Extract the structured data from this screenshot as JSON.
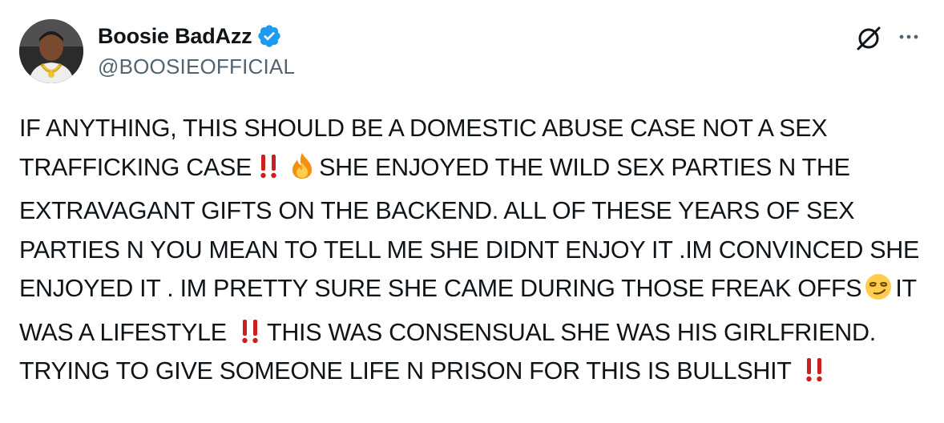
{
  "author": {
    "display_name": "Boosie BadAzz",
    "handle": "@BOOSIEOFFICIAL",
    "verified": true,
    "avatar_icon": "profile-photo"
  },
  "actions": {
    "grok_icon": "grok-icon",
    "more_icon": "more-options-icon"
  },
  "colors": {
    "verified_badge": "#1d9bf0",
    "handle": "#536471",
    "text": "#0f1419",
    "bang_emoji": "#cc1f1f"
  },
  "tweet": {
    "seg1": "IF ANYTHING, THIS SHOULD BE A DOMESTIC ABUSE CASE NOT A SEX TRAFFICKING CASE",
    "seg2": "SHE ENJOYED THE WILD SEX PARTIES N THE EXTRAVAGANT GIFTS ON THE BACKEND. ALL OF THESE YEARS OF SEX PARTIES N YOU MEAN TO TELL ME SHE DIDNT ENJOY IT .IM CONVINCED SHE ENJOYED IT . IM PRETTY SURE SHE CAME DURING THOSE FREAK OFFS",
    "seg3": "IT WAS A LIFESTYLE",
    "seg4": "THIS WAS CONSENSUAL SHE WAS HIS GIRLFRIEND. TRYING TO GIVE SOMEONE LIFE N PRISON FOR THIS IS BULLSHIT",
    "emojis": [
      "double-exclamation",
      "fire",
      "smirk-face",
      "double-exclamation",
      "double-exclamation"
    ]
  }
}
